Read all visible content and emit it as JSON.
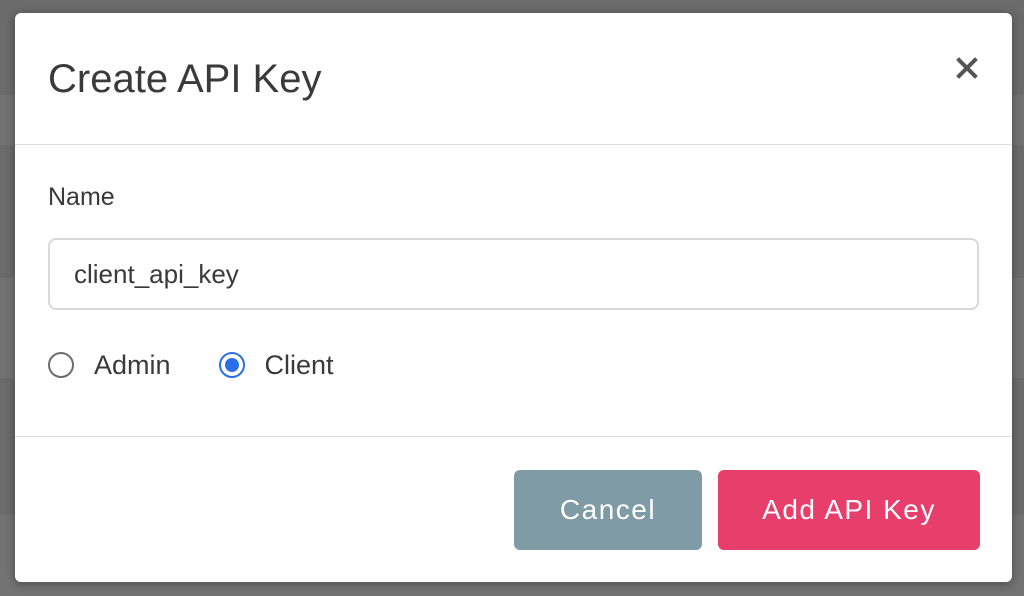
{
  "dialog": {
    "title": "Create API Key",
    "close_icon": "close-icon"
  },
  "form": {
    "name_label": "Name",
    "name_value": "client_api_key",
    "role_options": [
      {
        "label": "Admin",
        "checked": false
      },
      {
        "label": "Client",
        "checked": true
      }
    ]
  },
  "footer": {
    "cancel_label": "Cancel",
    "submit_label": "Add API Key"
  },
  "colors": {
    "primary_button": "#e83e6c",
    "cancel_button": "#7f9ba5",
    "radio_selected": "#2a6ee8",
    "overlay": "#6b6b6b"
  }
}
